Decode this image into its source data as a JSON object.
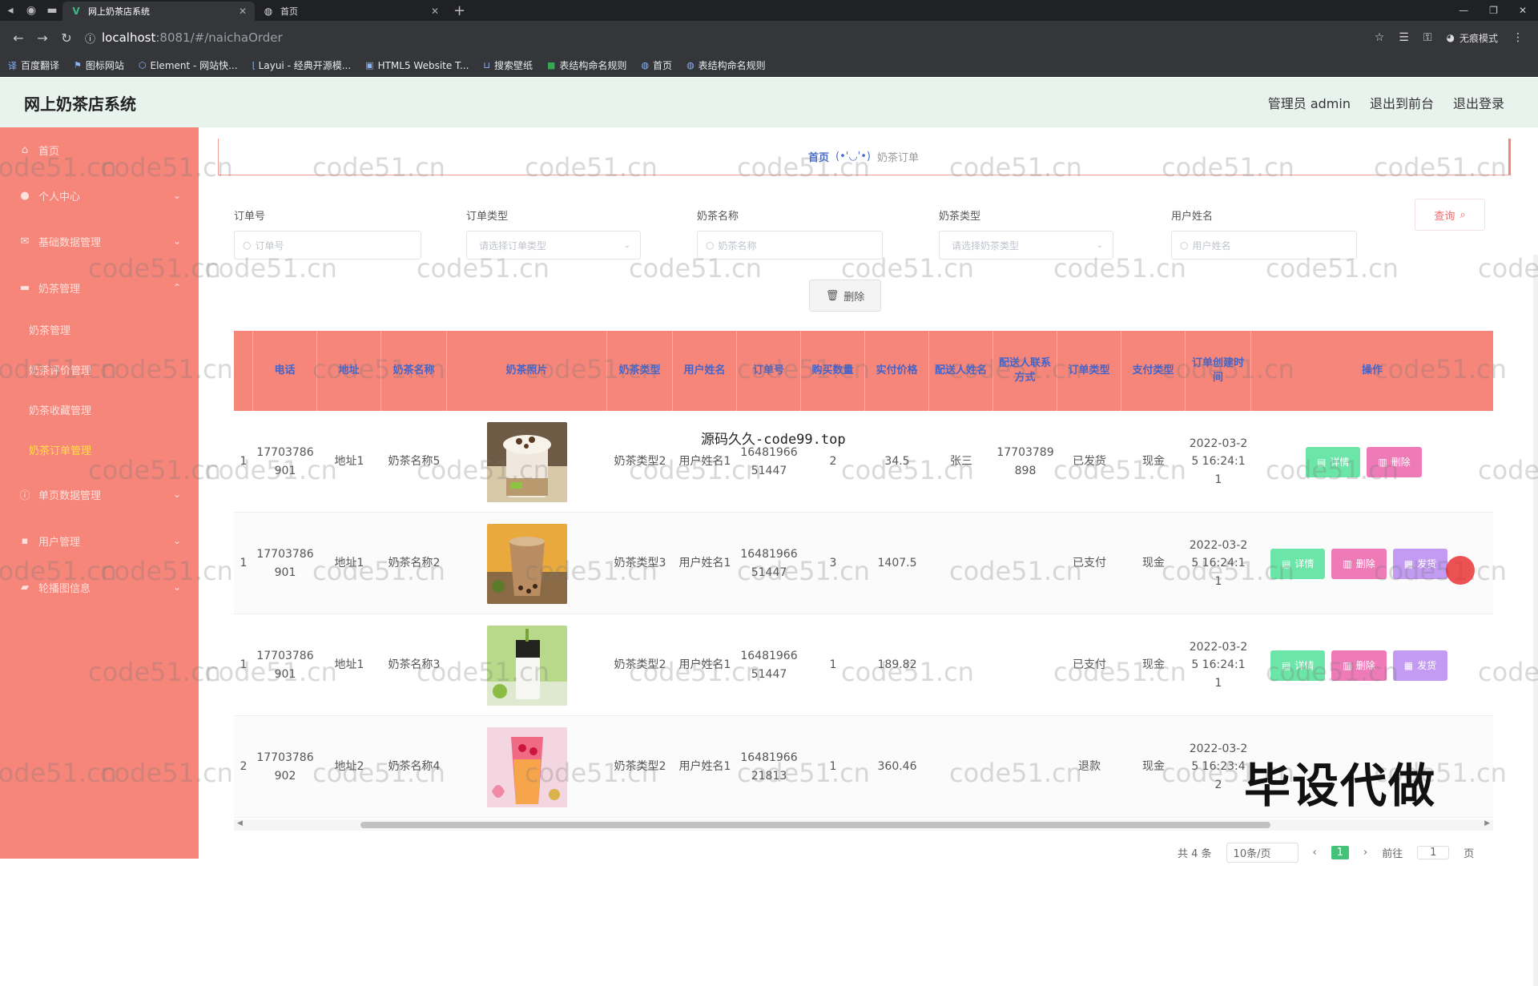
{
  "browser": {
    "tabs": [
      {
        "title": "网上奶茶店系统",
        "icon": "vue-icon",
        "active": true
      },
      {
        "title": "首页",
        "icon": "globe-icon",
        "active": false
      }
    ],
    "url_host": "localhost",
    "url_path": ":8081/#/naichaOrder",
    "profile_label": "无痕模式",
    "bookmarks": [
      "百度翻译",
      "图标网站",
      "Element - 网站快...",
      "Layui - 经典开源模...",
      "HTML5 Website T...",
      "搜索壁纸",
      "表结构命名规则",
      "首页",
      "表结构命名规则"
    ]
  },
  "header": {
    "title": "网上奶茶店系统",
    "admin_label": "管理员 admin",
    "front_label": "退出到前台",
    "logout_label": "退出登录"
  },
  "sidebar": {
    "items": [
      {
        "label": "首页",
        "icon": "home-icon",
        "arrow": ""
      },
      {
        "label": "个人中心",
        "icon": "user-icon",
        "arrow": "⌄"
      },
      {
        "label": "基础数据管理",
        "icon": "mail-icon",
        "arrow": "⌄"
      },
      {
        "label": "奶茶管理",
        "icon": "folder-icon",
        "arrow": "⌃"
      },
      {
        "label": "奶茶管理",
        "icon": "",
        "arrow": "",
        "sub": true
      },
      {
        "label": "奶茶评价管理",
        "icon": "",
        "arrow": "",
        "sub": true
      },
      {
        "label": "奶茶收藏管理",
        "icon": "",
        "arrow": "",
        "sub": true
      },
      {
        "label": "奶茶订单管理",
        "icon": "",
        "arrow": "",
        "sub": true,
        "active": true
      },
      {
        "label": "单页数据管理",
        "icon": "info-icon",
        "arrow": "⌄"
      },
      {
        "label": "用户管理",
        "icon": "lock-icon",
        "arrow": "⌄"
      },
      {
        "label": "轮播图信息",
        "icon": "book-icon",
        "arrow": "⌄"
      }
    ]
  },
  "breadcrumb": {
    "home": "首页",
    "face": "(•'◡'•)",
    "current": "奶茶订单"
  },
  "filters": [
    {
      "label": "订单号",
      "placeholder": "订单号",
      "type": "input"
    },
    {
      "label": "订单类型",
      "placeholder": "请选择订单类型",
      "type": "select"
    },
    {
      "label": "奶茶名称",
      "placeholder": "奶茶名称",
      "type": "input"
    },
    {
      "label": "奶茶类型",
      "placeholder": "请选择奶茶类型",
      "type": "select"
    },
    {
      "label": "用户姓名",
      "placeholder": "用户姓名",
      "type": "input"
    }
  ],
  "buttons": {
    "query": "查询",
    "delete": "删除"
  },
  "table": {
    "headers": [
      "",
      "电话",
      "地址",
      "奶茶名称",
      "奶茶照片",
      "奶茶类型",
      "用户姓名",
      "订单号",
      "购买数量",
      "实付价格",
      "配送人姓名",
      "配送人联系方式",
      "订单类型",
      "支付类型",
      "订单创建时间",
      "操作"
    ],
    "rows": [
      {
        "idx": "1",
        "phone": "17703786901",
        "addr": "地址1",
        "name": "奶茶名称5",
        "type": "奶茶类型2",
        "user": "用户姓名1",
        "order": "1648196651447",
        "qty": "2",
        "price": "34.5",
        "courier": "张三",
        "courier_phone": "17703789898",
        "otype": "已发货",
        "pay": "现金",
        "time": "2022-03-25 16:24:11",
        "ops": [
          "详情",
          "删除"
        ]
      },
      {
        "idx": "1",
        "phone": "17703786901",
        "addr": "地址1",
        "name": "奶茶名称2",
        "type": "奶茶类型3",
        "user": "用户姓名1",
        "order": "1648196651447",
        "qty": "3",
        "price": "1407.5",
        "courier": "",
        "courier_phone": "",
        "otype": "已支付",
        "pay": "现金",
        "time": "2022-03-25 16:24:11",
        "ops": [
          "详情",
          "删除",
          "发货"
        ]
      },
      {
        "idx": "1",
        "phone": "17703786901",
        "addr": "地址1",
        "name": "奶茶名称3",
        "type": "奶茶类型2",
        "user": "用户姓名1",
        "order": "1648196651447",
        "qty": "1",
        "price": "189.82",
        "courier": "",
        "courier_phone": "",
        "otype": "已支付",
        "pay": "现金",
        "time": "2022-03-25 16:24:11",
        "ops": [
          "详情",
          "删除",
          "发货"
        ]
      },
      {
        "idx": "2",
        "phone": "17703786902",
        "addr": "地址2",
        "name": "奶茶名称4",
        "type": "奶茶类型2",
        "user": "用户姓名1",
        "order": "1648196621813",
        "qty": "1",
        "price": "360.46",
        "courier": "",
        "courier_phone": "",
        "otype": "退款",
        "pay": "现金",
        "time": "2022-03-25 16:23:42",
        "ops": []
      }
    ]
  },
  "pagination": {
    "total": "共 4 条",
    "page_size": "10条/页",
    "current": "1",
    "goto": "前往",
    "goto_value": "1",
    "page_unit": "页"
  },
  "overlays": {
    "watermark": "code51.cn",
    "small_text": "源码久久-code99.top",
    "big_text": "毕设代做"
  },
  "colors": {
    "sidebar": "#f6867a",
    "header": "#e9f3ee",
    "detail": "#6ce6a8",
    "delete": "#ef7ab8",
    "ship": "#c49bf3",
    "active_menu": "#ffe23c"
  }
}
